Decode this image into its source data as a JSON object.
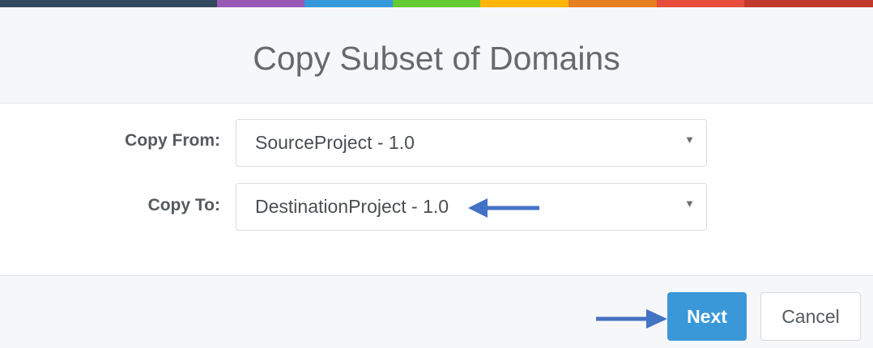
{
  "colors": {
    "top_bar": [
      "#34495e",
      "#9b59b6",
      "#3498db",
      "#62cb31",
      "#ffb606",
      "#e67e22",
      "#e74c3c",
      "#c0392b"
    ],
    "primary": "#3a98d9",
    "annotation_arrow": "#4472c4"
  },
  "dialog": {
    "title": "Copy Subset of Domains",
    "copy_from": {
      "label": "Copy From:",
      "value": "SourceProject - 1.0",
      "icon": "caret-down-icon"
    },
    "copy_to": {
      "label": "Copy To:",
      "value": "DestinationProject - 1.0",
      "icon": "caret-down-icon"
    },
    "buttons": {
      "next": "Next",
      "cancel": "Cancel"
    },
    "caret_glyph": "▼"
  }
}
